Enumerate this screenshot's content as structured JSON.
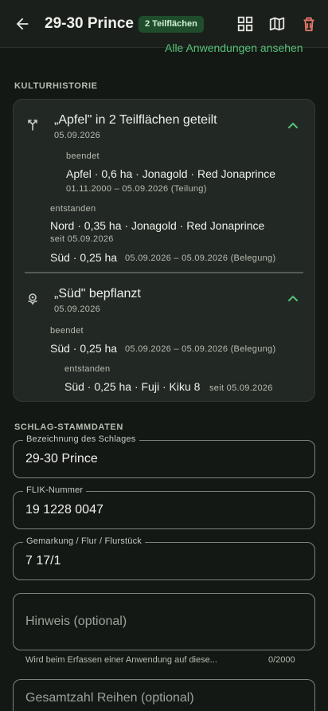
{
  "header": {
    "title": "29-30 Prince",
    "badge": "2 Teilflächen",
    "icons": [
      "back-arrow-icon",
      "dashboard-icon",
      "map-icon",
      "delete-icon"
    ],
    "colors": {
      "accent": "#57c27a",
      "danger": "#e5776a",
      "badge_bg": "#1f4d2c"
    }
  },
  "link": {
    "label": "Alle Anwendungen ansehen"
  },
  "history": {
    "section_label": "KULTURHISTORIE",
    "event1": {
      "icon": "split-icon",
      "title": "„Apfel\" in 2 Teilflächen geteilt",
      "date": "05.09.2026",
      "ended_label": "beendet",
      "ended_item": "Apfel · 0,6 ha · Jonagold · Red Jonaprince",
      "ended_range": "01.11.2000 – 05.09.2026 (Teilung)",
      "created_label": "entstanden",
      "created_item1": "Nord · 0,35 ha · Jonagold · Red Jonaprince",
      "created_item1_since": "seit 05.09.2026",
      "created_item2": "Süd · 0,25 ha",
      "created_item2_range": "05.09.2026 – 05.09.2026 (Belegung)"
    },
    "event2": {
      "icon": "plant-icon",
      "title": "„Süd\" bepflanzt",
      "date": "05.09.2026",
      "ended_label": "beendet",
      "ended_item": "Süd · 0,25 ha",
      "ended_range": "05.09.2026 – 05.09.2026 (Belegung)",
      "created_label": "entstanden",
      "created_item": "Süd · 0,25 ha · Fuji · Kiku 8",
      "created_since": "seit 05.09.2026"
    }
  },
  "stammdaten": {
    "section_label": "SCHLAG-STAMMDATEN",
    "name_label": "Bezeichnung des Schlages",
    "name_value": "29-30 Prince",
    "flik_label": "FLIK-Nummer",
    "flik_value": "19 1228 0047",
    "gemarkung_label": "Gemarkung / Flur / Flurstück",
    "gemarkung_value": "7 17/1",
    "hinweis_placeholder": "Hinweis (optional)",
    "hinweis_helper": "Wird beim Erfassen einer Anwendung auf diese...",
    "hinweis_counter": "0/2000",
    "reihen_placeholder": "Gesamtzahl Reihen (optional)"
  }
}
